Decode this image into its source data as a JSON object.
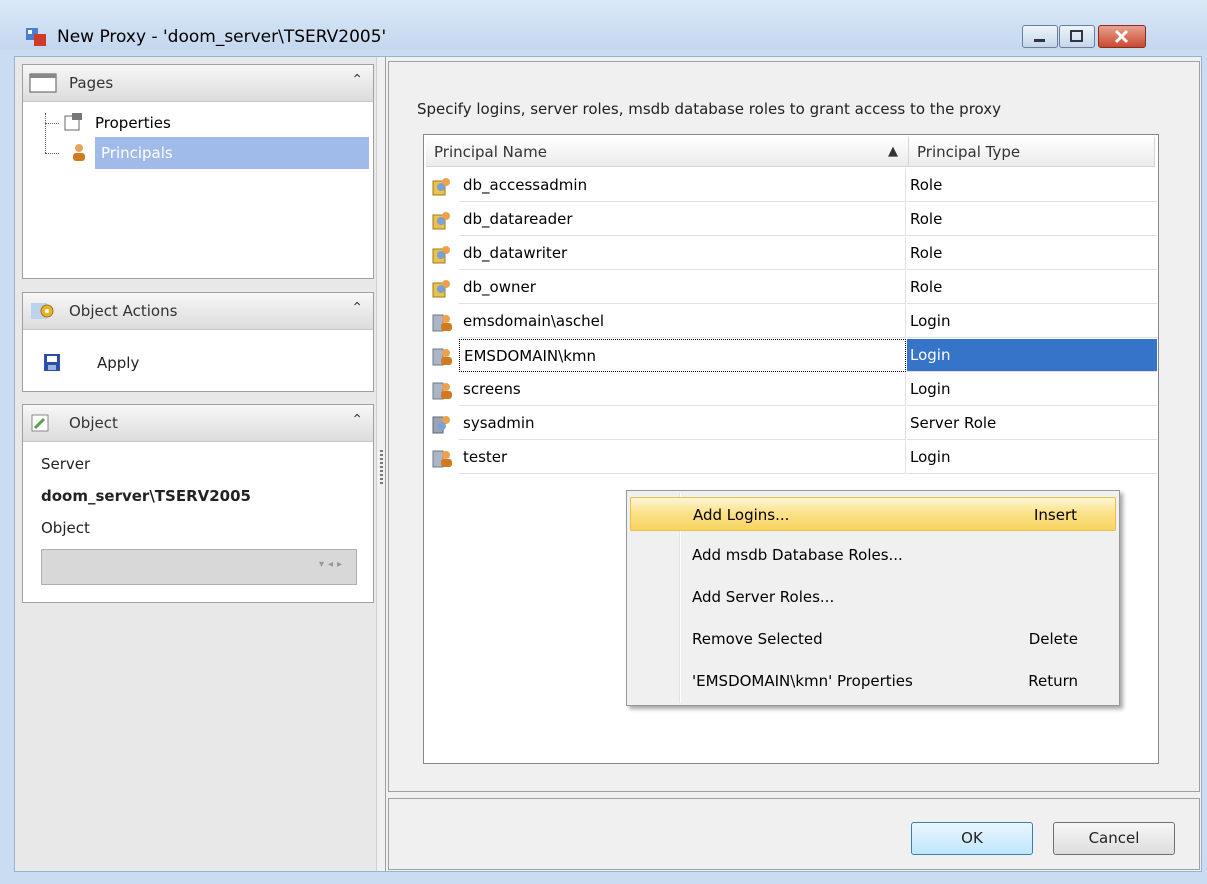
{
  "window": {
    "title": "New Proxy - 'doom_server\\TSERV2005'"
  },
  "left": {
    "pages": {
      "header": "Pages",
      "items": [
        {
          "label": "Properties"
        },
        {
          "label": "Principals"
        }
      ]
    },
    "actions": {
      "header": "Object Actions",
      "apply_label": "Apply"
    },
    "object": {
      "header": "Object",
      "server_label": "Server",
      "server_value": "doom_server\\TSERV2005",
      "object_label": "Object",
      "object_value": ""
    }
  },
  "main": {
    "instruction": "Specify logins, server roles, msdb database roles to grant access to the proxy",
    "columns": {
      "name": "Principal Name",
      "type": "Principal Type"
    },
    "rows": [
      {
        "name": "db_accessadmin",
        "type": "Role"
      },
      {
        "name": "db_datareader",
        "type": "Role"
      },
      {
        "name": "db_datawriter",
        "type": "Role"
      },
      {
        "name": "db_owner",
        "type": "Role"
      },
      {
        "name": "emsdomain\\aschel",
        "type": "Login"
      },
      {
        "name": "EMSDOMAIN\\kmn",
        "type": "Login"
      },
      {
        "name": "screens",
        "type": "Login"
      },
      {
        "name": "sysadmin",
        "type": "Server Role"
      },
      {
        "name": "tester",
        "type": "Login"
      }
    ]
  },
  "context_menu": {
    "items": [
      {
        "label": "Add Logins...",
        "shortcut": "Insert"
      },
      {
        "label": "Add msdb Database Roles...",
        "shortcut": ""
      },
      {
        "label": "Add Server Roles...",
        "shortcut": ""
      },
      {
        "label": "Remove Selected",
        "shortcut": "Delete"
      },
      {
        "label": "'EMSDOMAIN\\kmn' Properties",
        "shortcut": "Return"
      }
    ]
  },
  "buttons": {
    "ok": "OK",
    "cancel": "Cancel"
  },
  "colors": {
    "selection": "#3574c9",
    "tree_selection": "#a0bbea",
    "menu_highlight": "#fbe28d"
  }
}
